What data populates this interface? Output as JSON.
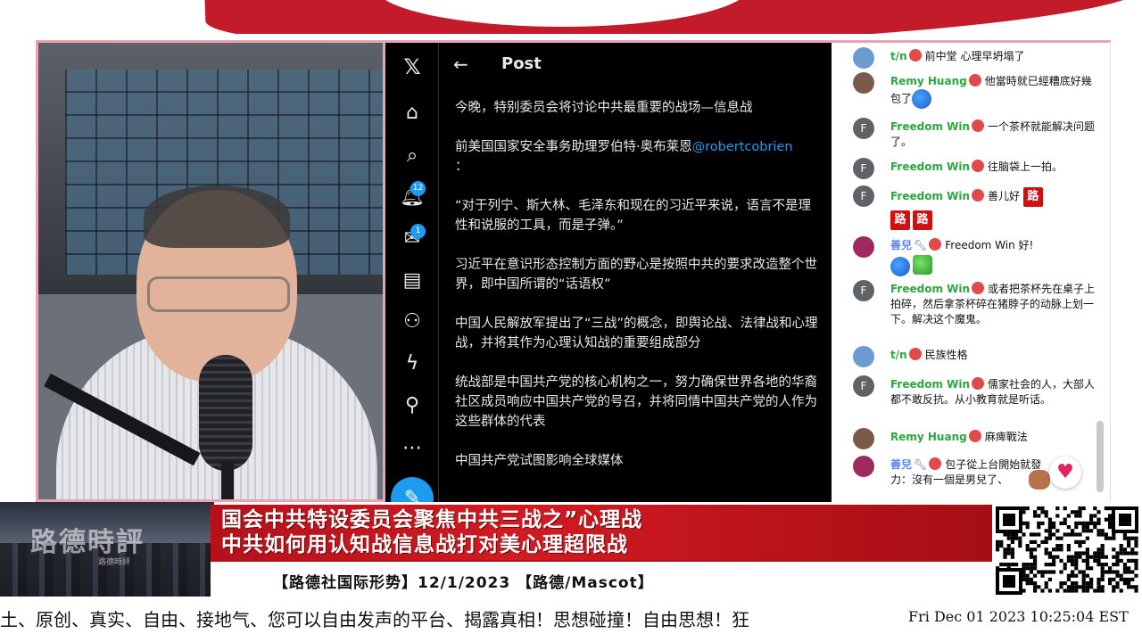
{
  "x_panel": {
    "header_title": "Post",
    "nav_badges": {
      "notifications": "12",
      "messages": "1"
    },
    "post_paragraphs": [
      "今晚，特别委员会将讨论中共最重要的战场—信息战",
      "“对于列宁、斯大林、毛泽东和现在的习近平来说，语言不是理性和说服的工具，而是子弹。”",
      "习近平在意识形态控制方面的野心是按照中共的要求改造整个世界，即中国所谓的“话语权”",
      "中国人民解放军提出了“三战”的概念，即舆论战、法律战和心理战，并将其作为心理认知战的重要组成部分",
      "统战部是中国共产党的核心机构之一，努力确保世界各地的华裔社区成员响应中国共产党的号召，并将同情中国共产党的人作为这些群体的代表",
      "中国共产党试图影响全球媒体"
    ],
    "quote_intro": "前美国国家安全事务助理罗伯特·奥布莱恩",
    "mention": "@robertcobrien",
    "quote_colon": "："
  },
  "chat": {
    "messages": [
      {
        "author": "t/n",
        "text": "前中堂 心理早坍塌了"
      },
      {
        "author": "Remy Huang",
        "text": "他當時就已經糟底好幾包了"
      },
      {
        "author": "Freedom Win",
        "text": "一个茶杯就能解决问题了。"
      },
      {
        "author": "Freedom Win",
        "text": "往脑袋上一拍。"
      },
      {
        "author": "Freedom Win",
        "text": "善儿好"
      },
      {
        "author": "善兒",
        "text": "Freedom Win 好!"
      },
      {
        "author": "Freedom Win",
        "text": "或者把茶杯先在桌子上拍碎，然后拿茶杯碎在猪脖子的动脉上划一下。解决这个魔鬼。"
      },
      {
        "author": "t/n",
        "text": "民族性格"
      },
      {
        "author": "Freedom Win",
        "text": "儒家社会的人，大部人都不敢反抗。从小教育就是听话。"
      },
      {
        "author": "Remy Huang",
        "text": "麻痺戰法"
      },
      {
        "author": "善兒",
        "text": "包子從上台開始就發力：沒有一個是男兒了、"
      }
    ],
    "lu_char": "路",
    "avatar_letter": "F"
  },
  "lower_third": {
    "brand": "路德時評",
    "brand_sub": "路德時評",
    "headline_line1": "国会中共特设委员会聚焦中共三战之”心理战",
    "headline_line2": "中共如何用认知战信息战打对美心理超限战",
    "subline": "【路德社国际形势】12/1/2023 【路德/Mascot】"
  },
  "ticker": {
    "scroll_text": "土、原创、真实、自由、接地气、您可以自由发声的平台、揭露真相！思想碰撞！自由思想！狂",
    "clock": "Fri Dec 01 2023 10:25:04 EST"
  },
  "colors": {
    "accent_red": "#c41b2a",
    "x_blue": "#1d9bf0",
    "chat_green": "#2ba640",
    "frame_pink": "#e8a3b4"
  }
}
